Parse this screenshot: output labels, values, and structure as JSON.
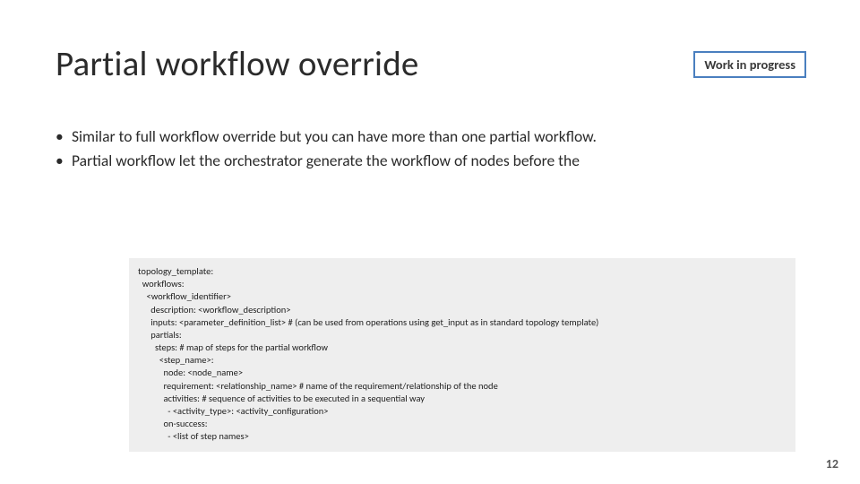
{
  "title": "Partial workflow override",
  "badge": "Work in progress",
  "bullets": [
    "Similar to full workflow override but you can have more than one partial workflow.",
    "Partial workflow let the orchestrator generate the workflow of nodes before the"
  ],
  "code": {
    "l1": "topology_template:",
    "l2": "  workflows:",
    "l3": "    <workflow_identifier>",
    "l4": "      description: <workflow_description>",
    "l5": "      inputs: <parameter_definition_list> # (can be used from operations using get_input as in standard topology template)",
    "l6": "      partials:",
    "l7": "        steps: # map of steps for the partial workflow",
    "l8": "          <step_name>:",
    "l9": "            node: <node_name>",
    "l10": "            requirement: <relationship_name> # name of the requirement/relationship of the node",
    "l11": "            activities: # sequence of activities to be executed in a sequential way",
    "l12": "              - <activity_type>: <activity_configuration>",
    "l13": "            on-success:",
    "l14": "              - <list of step names>"
  },
  "page_number": "12"
}
